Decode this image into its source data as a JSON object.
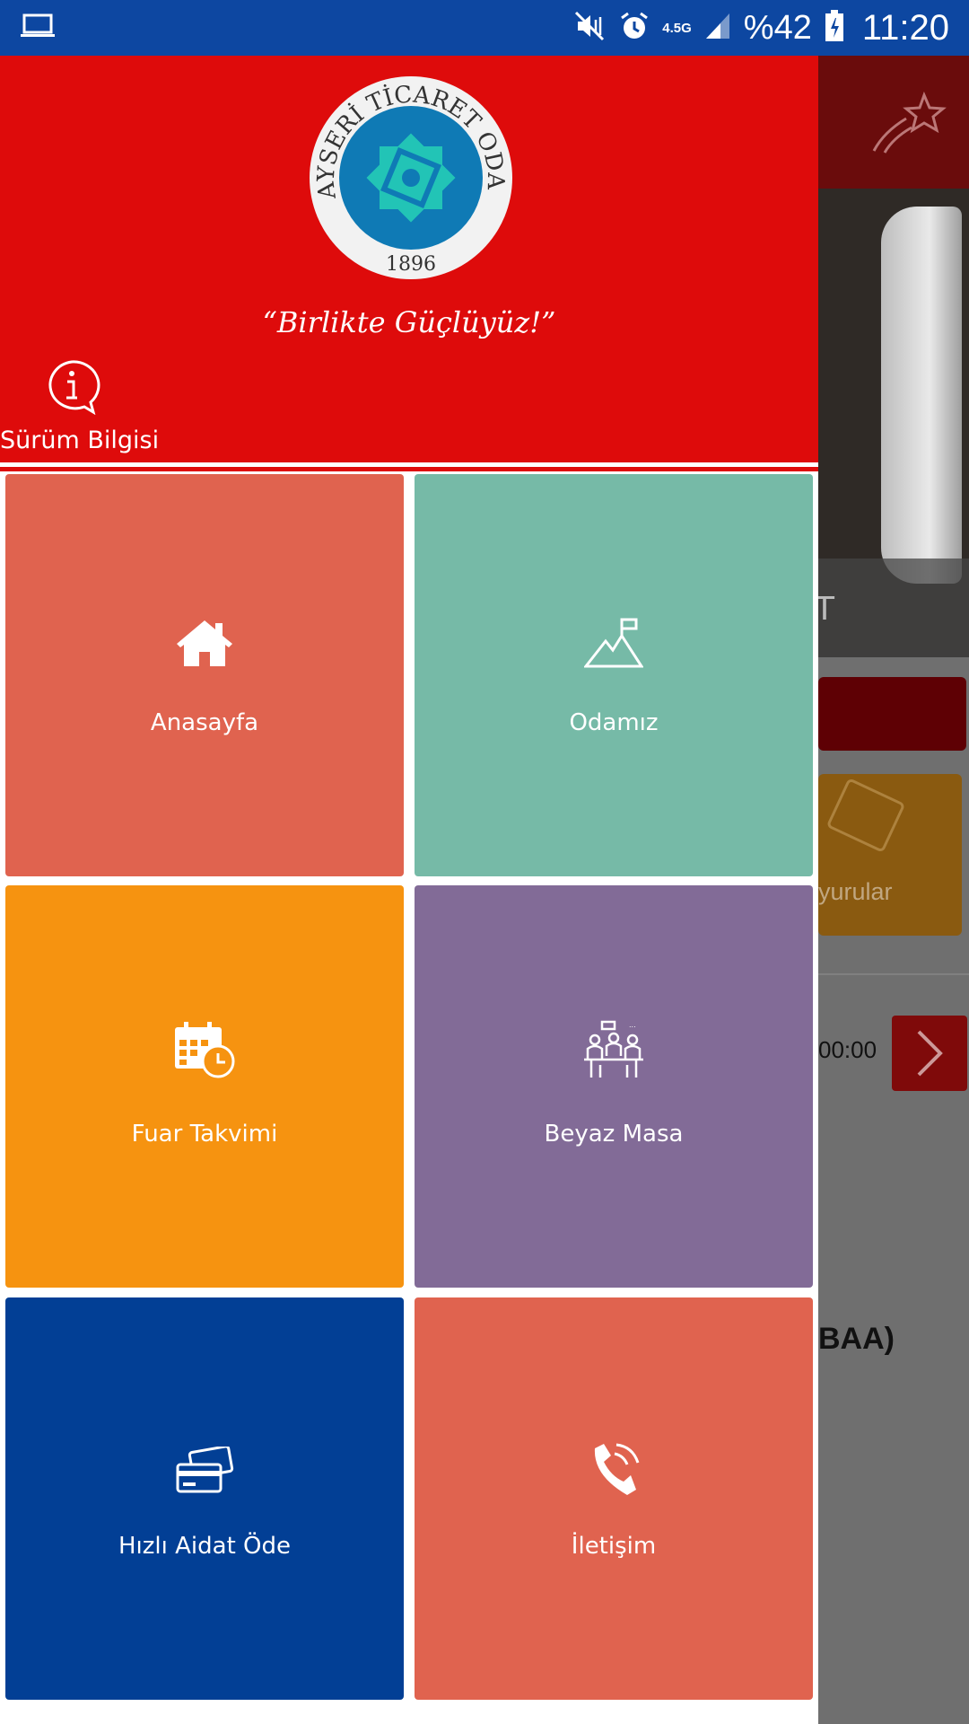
{
  "status_bar": {
    "network": "4.5G",
    "battery_percent": "%42",
    "time": "11:20",
    "icons": [
      "laptop-icon",
      "mute-vibrate-icon",
      "alarm-icon",
      "signal-icon",
      "battery-icon"
    ]
  },
  "drawer": {
    "logo": {
      "ring_text": "KAYSERİ TİCARET ODASI",
      "year": "1896"
    },
    "slogan": "“Birlikte Güçlüyüz!”",
    "version_label": "Sürüm Bilgisi",
    "menu": [
      {
        "label": "Anasayfa",
        "icon": "home-icon",
        "color": "#e0634f"
      },
      {
        "label": "Odamız",
        "icon": "flag-mountain-icon",
        "color": "#76baa7"
      },
      {
        "label": "Fuar Takvimi",
        "icon": "calendar-clock-icon",
        "color": "#f69310"
      },
      {
        "label": "Beyaz Masa",
        "icon": "meeting-table-icon",
        "color": "#826b97"
      },
      {
        "label": "Hızlı Aidat Öde",
        "icon": "credit-cards-icon",
        "color": "#023f95"
      },
      {
        "label": "İletişim",
        "icon": "phone-icon",
        "color": "#e0634f"
      }
    ]
  },
  "background_app": {
    "hero_text": "T",
    "card_label": "yurular",
    "time_text": "00:00",
    "heading_fragment": "BAA)"
  },
  "colors": {
    "header_red": "#de0b0b",
    "status_blue": "#0d47a1"
  }
}
